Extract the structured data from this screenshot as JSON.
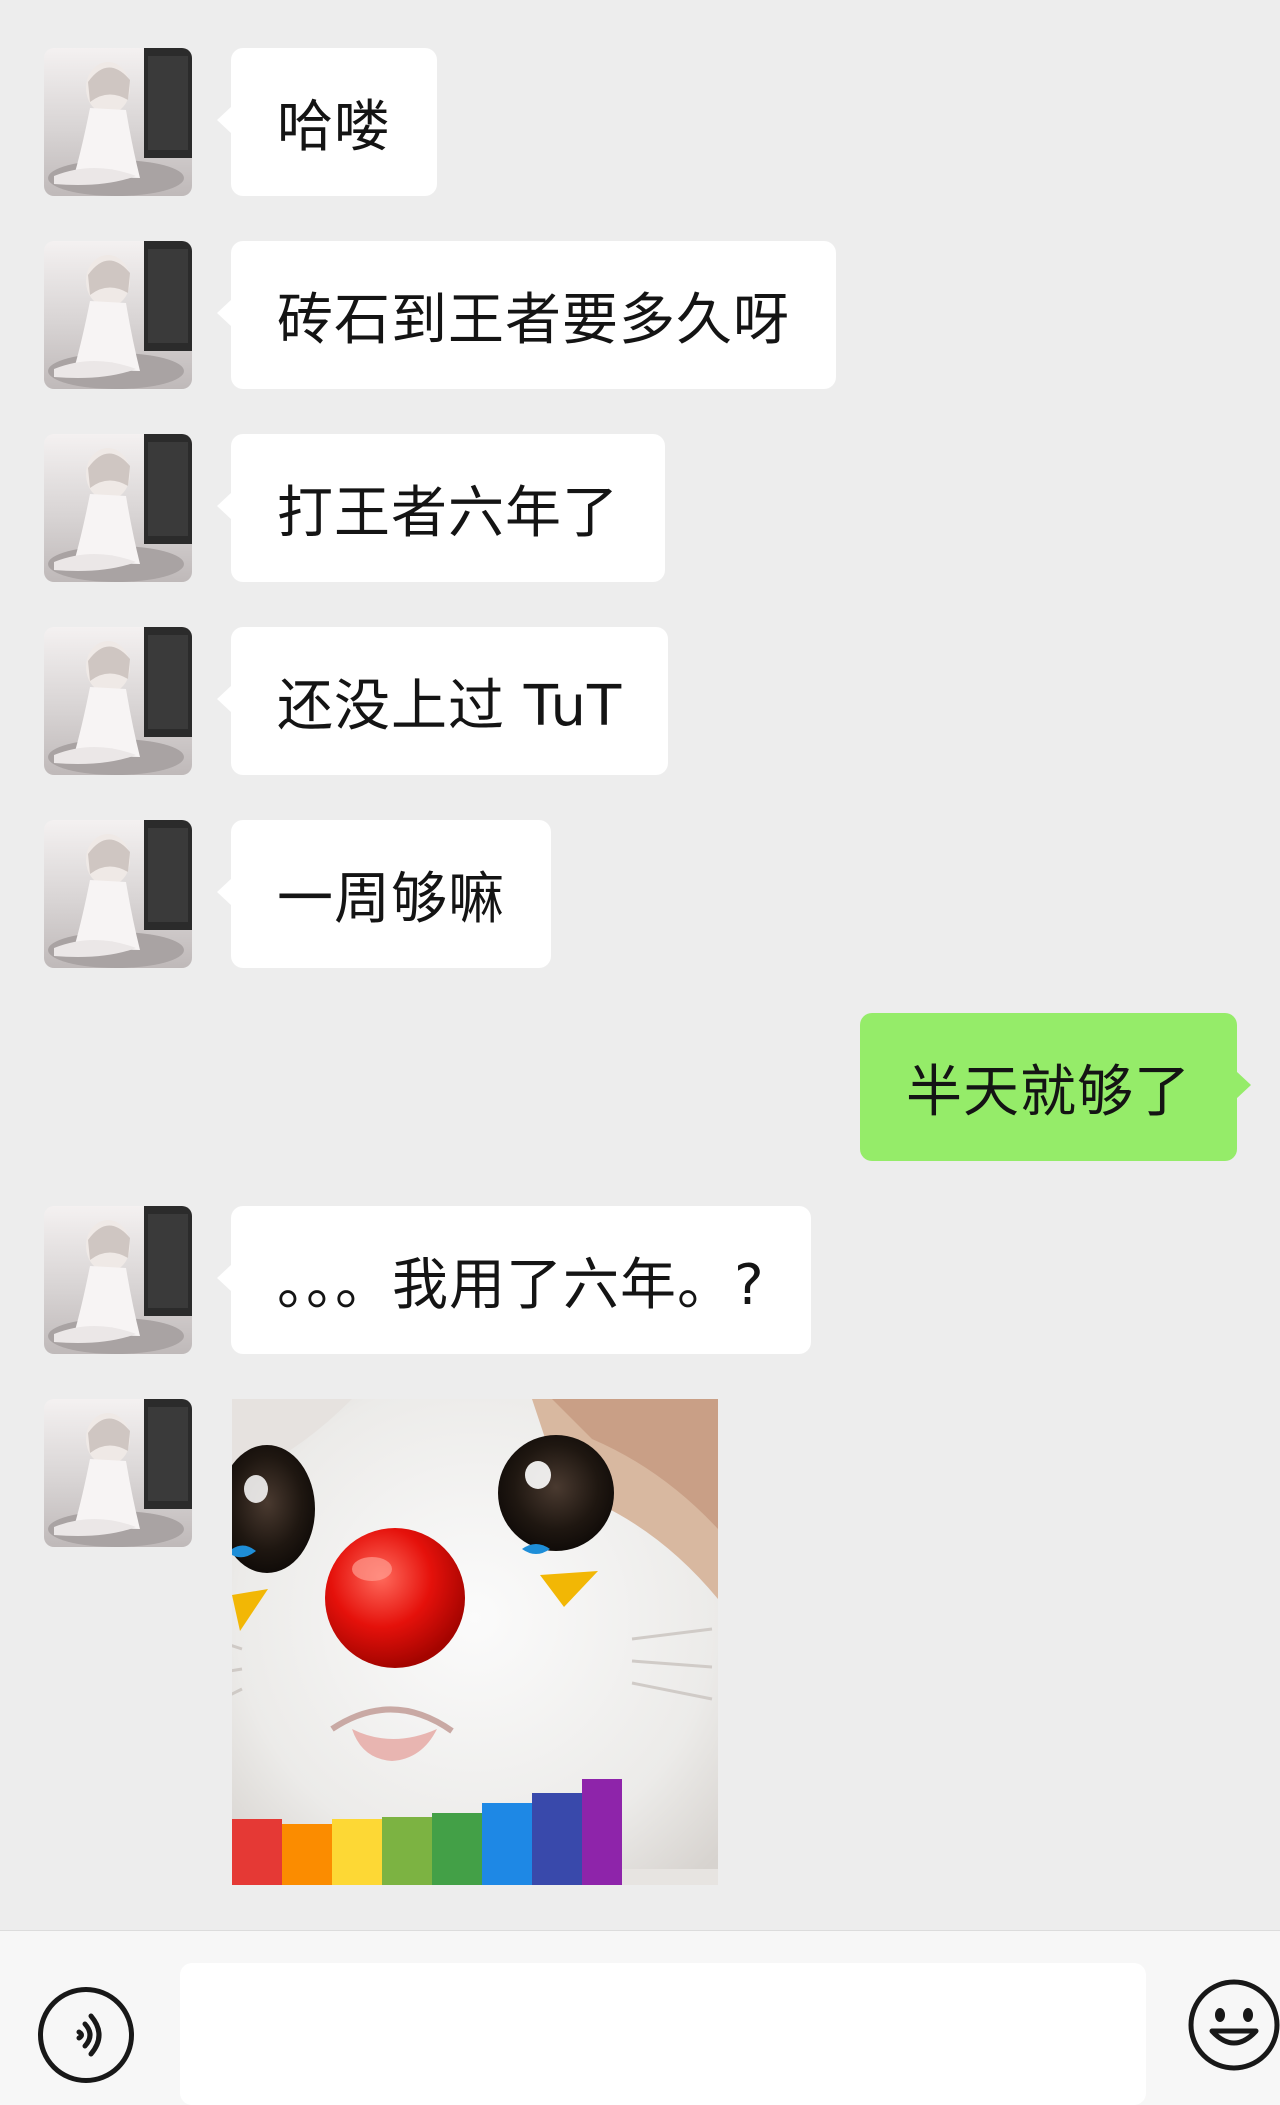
{
  "conversation": {
    "messages": [
      {
        "side": "in",
        "text": "哈喽"
      },
      {
        "side": "in",
        "text": "砖石到王者要多久呀"
      },
      {
        "side": "in",
        "text": "打王者六年了"
      },
      {
        "side": "in",
        "text": "还没上过 TuT"
      },
      {
        "side": "in",
        "text": "一周够嘛"
      },
      {
        "side": "out",
        "text": "半天就够了"
      },
      {
        "side": "in",
        "text": "。。。我用了六年。?"
      },
      {
        "side": "in",
        "type": "sticker",
        "sticker": "crying-clown-cat-sticker"
      }
    ]
  },
  "input_bar": {
    "voice_icon": "voice-icon",
    "emoji_icon": "emoji-icon",
    "input_value": ""
  },
  "colors": {
    "background": "#ededed",
    "incoming_bubble": "#ffffff",
    "outgoing_bubble": "#95ec69",
    "input_bar": "#f7f7f7"
  }
}
